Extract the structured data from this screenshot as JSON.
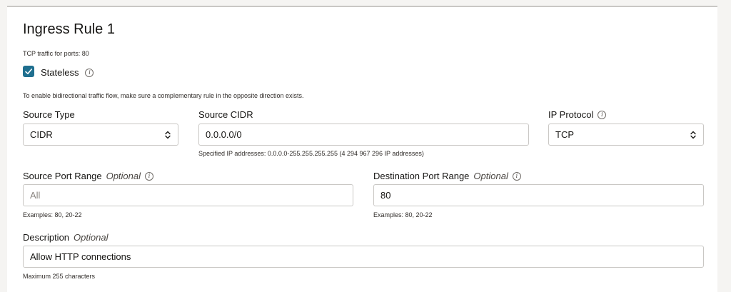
{
  "rule": {
    "title": "Ingress Rule 1",
    "subtitle": "TCP traffic for ports: 80"
  },
  "stateless": {
    "label": "Stateless",
    "checked": true,
    "hint": "To enable bidirectional traffic flow, make sure a complementary rule in the opposite direction exists."
  },
  "source_type": {
    "label": "Source Type",
    "value": "CIDR"
  },
  "source_cidr": {
    "label": "Source CIDR",
    "value": "0.0.0.0/0",
    "hint": "Specified IP addresses: 0.0.0.0-255.255.255.255 (4 294 967 296 IP addresses)"
  },
  "ip_protocol": {
    "label": "IP Protocol",
    "value": "TCP"
  },
  "source_port_range": {
    "label": "Source Port Range",
    "optional": "Optional",
    "placeholder": "All",
    "value": "",
    "hint": "Examples: 80, 20-22"
  },
  "destination_port_range": {
    "label": "Destination Port Range",
    "optional": "Optional",
    "value": "80",
    "hint": "Examples: 80, 20-22"
  },
  "description": {
    "label": "Description",
    "optional": "Optional",
    "value": "Allow HTTP connections",
    "hint": "Maximum 255 characters"
  },
  "colors": {
    "checkbox": "#1f6f8f",
    "border": "#c9c7c4",
    "background": "#f5f4f2"
  }
}
